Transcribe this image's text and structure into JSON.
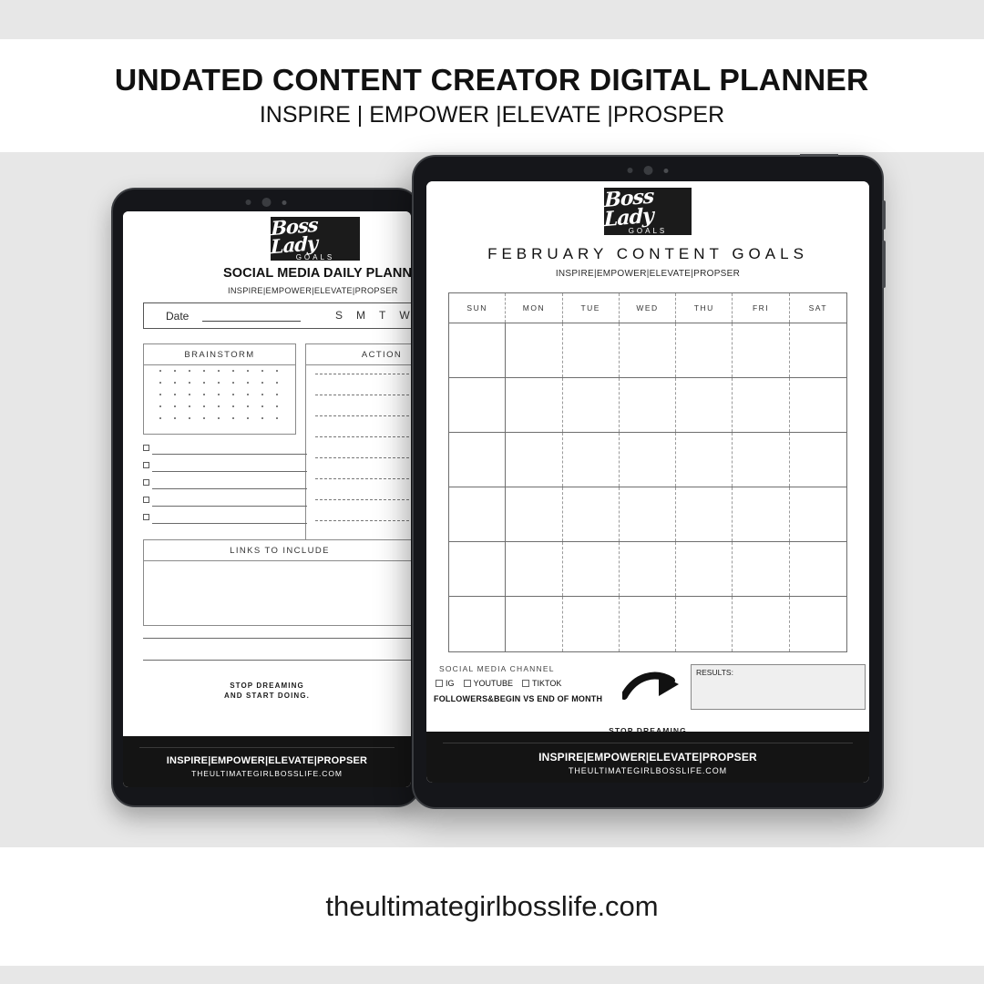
{
  "header": {
    "title": "UNDATED CONTENT CREATOR DIGITAL PLANNER",
    "subtitle": "INSPIRE | EMPOWER |ELEVATE |PROSPER"
  },
  "footer": {
    "url": "theultimategirlbosslife.com"
  },
  "brand": {
    "logo_script": "Boss Lady",
    "logo_sub": "GOALS",
    "tagline": "INSPIRE|EMPOWER|ELEVATE|PROPSER",
    "dark_footer_line1": "INSPIRE|EMPOWER|ELEVATE|PROPSER",
    "dark_footer_line2": "THEULTIMATEGIRLBOSSLIFE.COM",
    "motto_line1": "STOP DREAMING",
    "motto_line2": "AND START DOING."
  },
  "left_page": {
    "doc_title": "SOCIAL MEDIA DAILY PLANNER",
    "date_label": "Date",
    "day_letters": [
      "S",
      "M",
      "T",
      "W"
    ],
    "brainstorm_header": "BRAINSTORM",
    "action_header": "ACTION",
    "links_header": "LINKS TO INCLUDE",
    "checklist_rows": 5,
    "action_line_count": 8,
    "dot_grid": {
      "cols": 9,
      "rows": 5
    }
  },
  "right_page": {
    "calendar_title": "FEBRUARY CONTENT GOALS",
    "weekday_headers": [
      "SUN",
      "MON",
      "TUE",
      "WED",
      "THU",
      "FRI",
      "SAT"
    ],
    "week_rows": 6,
    "social_media_label": "SOCIAL MEDIA CHANNEL",
    "channels": [
      "IG",
      "YOUTUBE",
      "TIKTOK"
    ],
    "followers_line": "FOLLOWERS&BEGIN VS END OF MONTH",
    "results_label": "RESULTS:",
    "arrow_icon": "curved-arrow-right"
  },
  "colors": {
    "band_gray": "#e7e7e7",
    "page_white": "#ffffff",
    "tablet_body": "#15161a",
    "logo_black": "#1b1b1b",
    "dark_footer": "#141414",
    "results_fill": "#efefef"
  }
}
